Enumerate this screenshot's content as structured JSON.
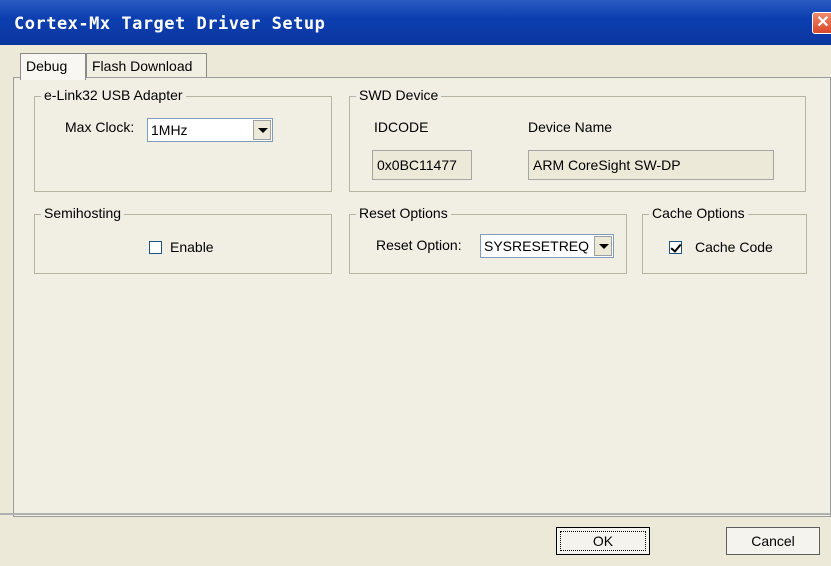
{
  "window": {
    "title": "Cortex-Mx Target Driver Setup"
  },
  "tabs": [
    {
      "label": "Debug"
    },
    {
      "label": "Flash Download"
    }
  ],
  "adapter": {
    "legend": "e-Link32 USB Adapter",
    "max_clock_label": "Max Clock:",
    "max_clock_value": "1MHz"
  },
  "swd": {
    "legend": "SWD Device",
    "idcode_header": "IDCODE",
    "device_name_header": "Device Name",
    "idcode_value": "0x0BC11477",
    "device_name_value": "ARM CoreSight SW-DP"
  },
  "semihosting": {
    "legend": "Semihosting",
    "enable_label": "Enable",
    "enabled": false
  },
  "reset": {
    "legend": "Reset Options",
    "option_label": "Reset Option:",
    "option_value": "SYSRESETREQ"
  },
  "cache": {
    "legend": "Cache Options",
    "cache_code_label": "Cache Code",
    "cache_code_checked": true
  },
  "buttons": {
    "ok": "OK",
    "cancel": "Cancel"
  },
  "colors": {
    "titlebar": "#0a36a0",
    "dialog_bg": "#ece9d8",
    "watermark": "#f3d6cc"
  },
  "icons": {
    "close": "close-icon",
    "dropdown": "chevron-down-icon"
  }
}
